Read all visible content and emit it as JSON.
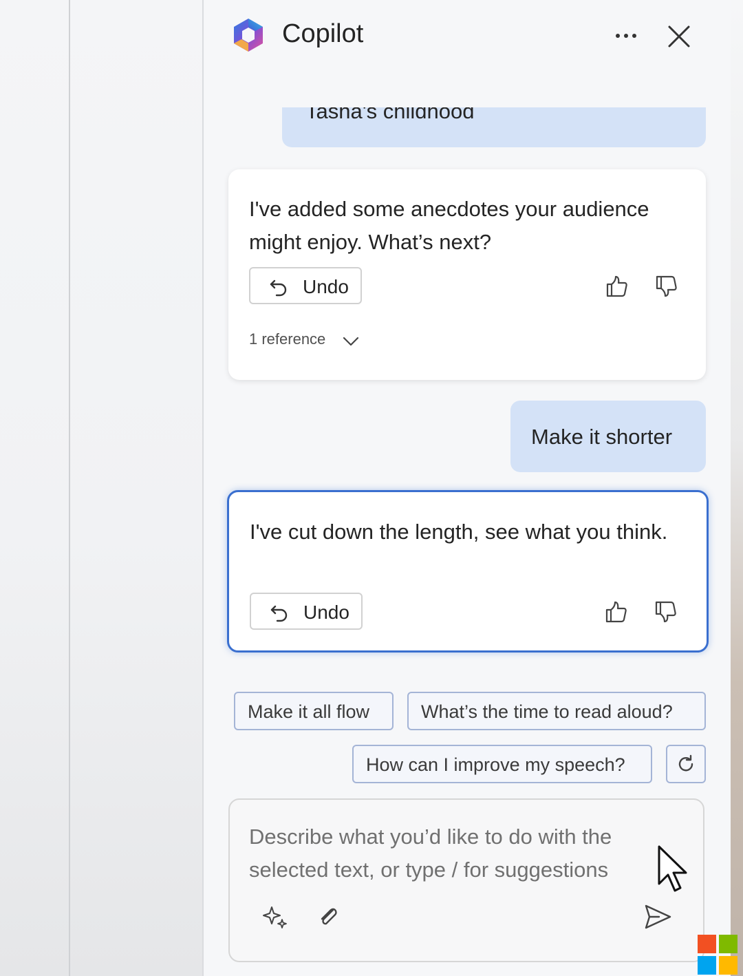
{
  "app": {
    "title": "Copilot",
    "accent_color": "#3a6fcf",
    "user_bubble_color": "#d4e2f7"
  },
  "header": {
    "logo_icon": "copilot-logo-icon",
    "more_icon": "more-horizontal-icon",
    "close_icon": "close-icon"
  },
  "messages": [
    {
      "role": "user",
      "text": "Tasha's childhood"
    },
    {
      "role": "assistant",
      "text": "I've added some anecdotes your audience might enjoy. What’s next?",
      "undo_label": "Undo",
      "reference_label": "1 reference"
    },
    {
      "role": "user",
      "text": "Make it shorter"
    },
    {
      "role": "assistant",
      "text": "I've cut down the length, see what you think.",
      "undo_label": "Undo"
    }
  ],
  "suggestions": [
    "Make it all flow",
    "What’s the time to read aloud?",
    "How can I improve my speech?"
  ],
  "composer": {
    "placeholder": "Describe what you’d like to do with the selected text, or type / for suggestions",
    "icons": [
      "sparkle-icon",
      "attach-icon",
      "send-icon"
    ]
  }
}
